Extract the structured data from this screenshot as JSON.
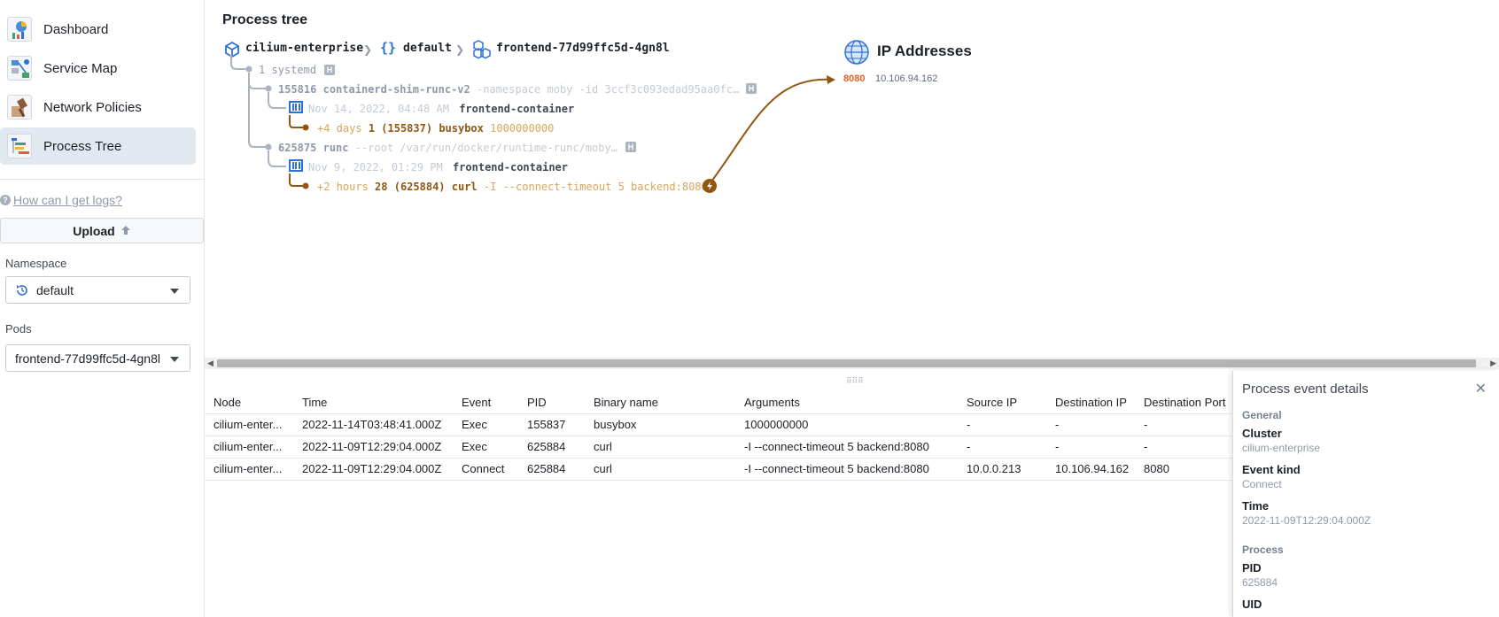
{
  "sidebar": {
    "nav": [
      {
        "label": "Dashboard",
        "icon": "dashboard-icon"
      },
      {
        "label": "Service Map",
        "icon": "service-map-icon"
      },
      {
        "label": "Network Policies",
        "icon": "network-policies-icon"
      },
      {
        "label": "Process Tree",
        "icon": "process-tree-icon",
        "active": true
      }
    ],
    "help_link": "How can I get logs?",
    "upload_label": "Upload",
    "namespace_label": "Namespace",
    "namespace_value": "default",
    "pods_label": "Pods",
    "pods_value": "frontend-77d99ffc5d-4gn8l"
  },
  "tree": {
    "title": "Process tree",
    "breadcrumb": {
      "cluster": "cilium-enterprise",
      "namespace": "default",
      "pod": "frontend-77d99ffc5d-4gn8l",
      "namespace_glyph": "{}"
    },
    "root": {
      "pid": "1",
      "name": "systemd",
      "badge": "H"
    },
    "proc1": {
      "pid": "155816",
      "name": "containerd-shim-runc-v2",
      "args": "-namespace moby -id 3ccf3c093edad95aa0fc…",
      "badge": "H"
    },
    "container1": {
      "time": "Nov 14, 2022, 04:48 AM",
      "name": "frontend-container"
    },
    "exec1": {
      "rel": "+4 days",
      "uid": "1",
      "pid": "(155837)",
      "binary": "busybox",
      "args": "1000000000"
    },
    "proc2": {
      "pid": "625875",
      "name": "runc",
      "args": "--root /var/run/docker/runtime-runc/moby…",
      "badge": "H"
    },
    "container2": {
      "time": "Nov 9, 2022, 01:29 PM",
      "name": "frontend-container"
    },
    "exec2": {
      "rel": "+2 hours",
      "uid": "28",
      "pid": "(625884)",
      "binary": "curl",
      "args": "-I --connect-timeout 5 backend:8080"
    }
  },
  "ip_panel": {
    "title": "IP Addresses",
    "port": "8080",
    "address": "10.106.94.162"
  },
  "table": {
    "headers": [
      "Node",
      "Time",
      "Event",
      "PID",
      "Binary name",
      "Arguments",
      "Source IP",
      "Destination IP",
      "Destination Port"
    ],
    "rows": [
      [
        "cilium-enter...",
        "2022-11-14T03:48:41.000Z",
        "Exec",
        "155837",
        "busybox",
        "1000000000",
        "-",
        "-",
        "-"
      ],
      [
        "cilium-enter...",
        "2022-11-09T12:29:04.000Z",
        "Exec",
        "625884",
        "curl",
        "-I --connect-timeout 5 backend:8080",
        "-",
        "-",
        "-"
      ],
      [
        "cilium-enter...",
        "2022-11-09T12:29:04.000Z",
        "Connect",
        "625884",
        "curl",
        "-I --connect-timeout 5 backend:8080",
        "10.0.0.213",
        "10.106.94.162",
        "8080"
      ]
    ]
  },
  "details": {
    "title": "Process event details",
    "general_label": "General",
    "cluster_key": "Cluster",
    "cluster_val": "cilium-enterprise",
    "kind_key": "Event kind",
    "kind_val": "Connect",
    "time_key": "Time",
    "time_val": "2022-11-09T12:29:04.000Z",
    "process_label": "Process",
    "pid_key": "PID",
    "pid_val": "625884",
    "uid_key": "UID"
  },
  "colors": {
    "accent": "#2d72d2",
    "connect_line": "#935610",
    "port": "#e85c1f",
    "exec": "#c87619"
  }
}
